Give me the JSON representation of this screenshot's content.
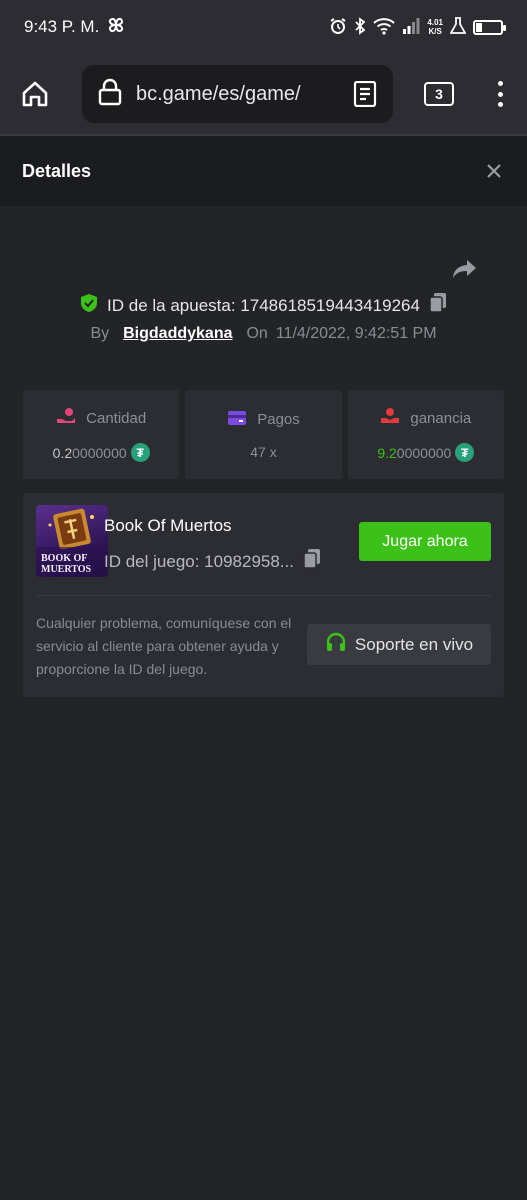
{
  "status_bar": {
    "time": "9:43 P. M.",
    "net_speed_value": "4.01",
    "net_speed_unit": "K/S"
  },
  "browser": {
    "url": "bc.game/es/game/",
    "tab_count": "3"
  },
  "modal": {
    "title": "Detalles"
  },
  "bet": {
    "id_label": "ID de la apuesta: 1748618519443419264",
    "by_label": "By",
    "username": "Bigdaddykana",
    "on_label": "On",
    "date": "11/4/2022, 9:42:51 PM"
  },
  "stats": {
    "amount_label": "Cantidad",
    "amount_strong": "0.2",
    "amount_rest": "0000000",
    "payout_label": "Pagos",
    "payout_value": "47 x",
    "profit_label": "ganancia",
    "profit_strong": "9.2",
    "profit_rest": "0000000"
  },
  "game": {
    "name": "Book Of Muertos",
    "id_label": "ID del juego: 10982958...",
    "thumb_text_1": "BOOK OF",
    "thumb_text_2": "MUERTOS",
    "play_button": "Jugar ahora",
    "support_text": "Cualquier problema, comuníquese con el servicio al cliente para obtener ayuda y proporcione la ID del juego.",
    "support_button": "Soporte en vivo"
  },
  "colors": {
    "accent_green": "#3bc117",
    "usdt_green": "#26a17b",
    "background": "#232428"
  }
}
